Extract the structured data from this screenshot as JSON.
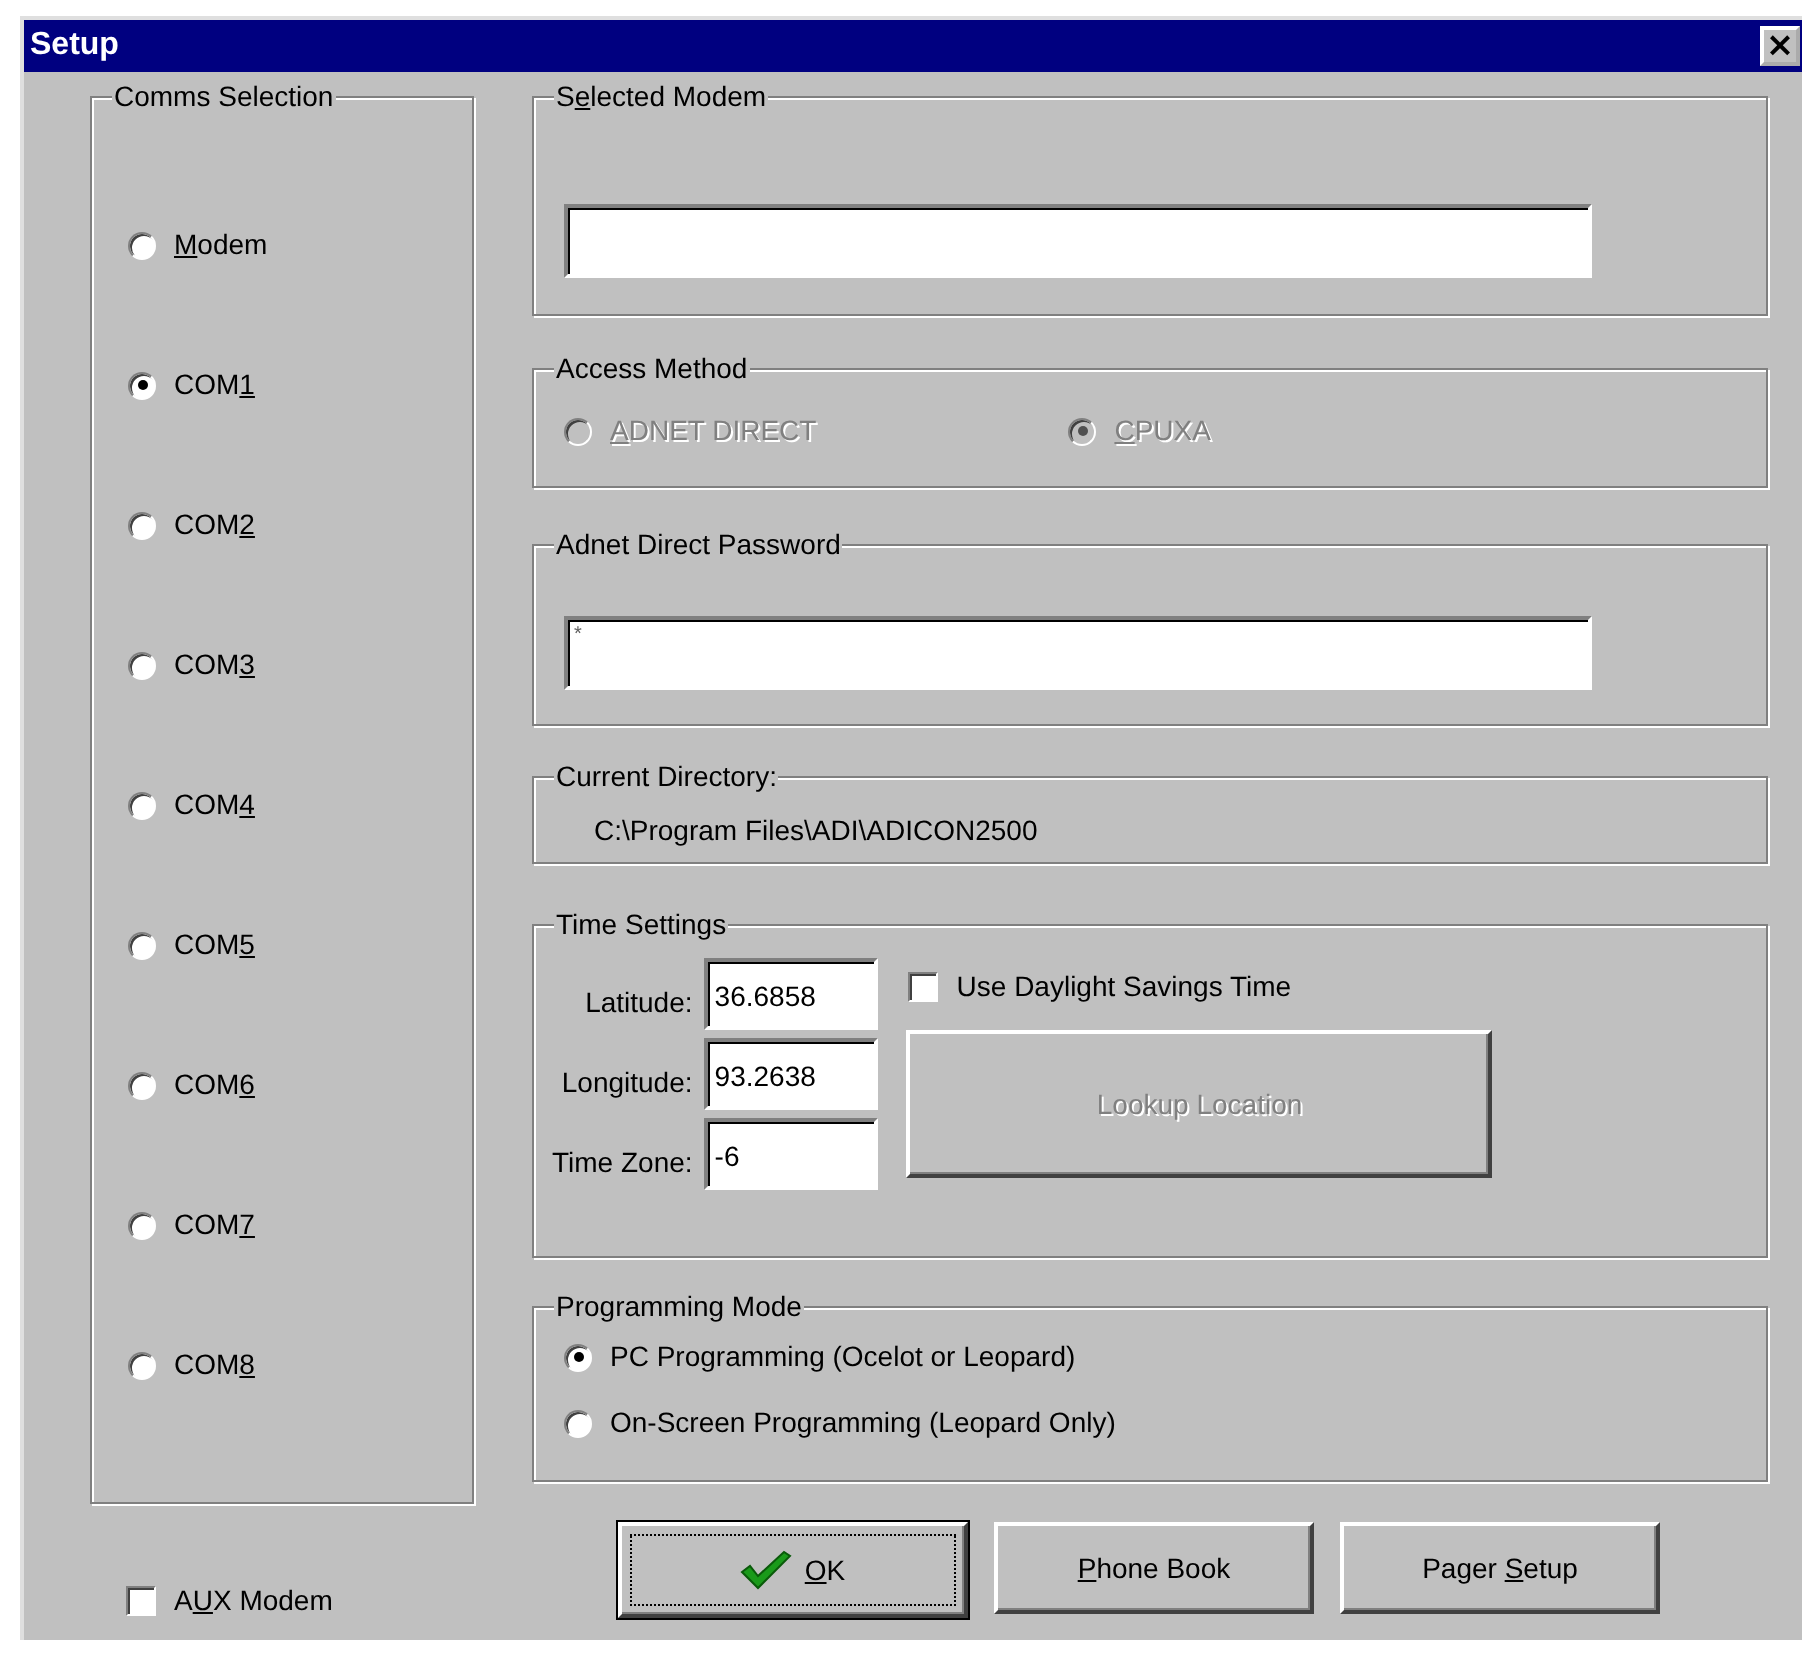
{
  "window": {
    "title": "Setup",
    "close": "×"
  },
  "comms_selection": {
    "title": "Comms Selection",
    "options": [
      {
        "label": [
          {
            "text": "M",
            "underlined": true
          },
          {
            "text": "odem"
          }
        ],
        "selected": false
      },
      {
        "label": [
          {
            "text": "COM"
          },
          {
            "text": "1",
            "underlined": true
          }
        ],
        "selected": true
      },
      {
        "label": [
          {
            "text": "COM"
          },
          {
            "text": "2",
            "underlined": true
          }
        ],
        "selected": false
      },
      {
        "label": [
          {
            "text": "COM"
          },
          {
            "text": "3",
            "underlined": true
          }
        ],
        "selected": false
      },
      {
        "label": [
          {
            "text": "COM"
          },
          {
            "text": "4",
            "underlined": true
          }
        ],
        "selected": false
      },
      {
        "label": [
          {
            "text": "COM"
          },
          {
            "text": "5",
            "underlined": true
          }
        ],
        "selected": false
      },
      {
        "label": [
          {
            "text": "COM"
          },
          {
            "text": "6",
            "underlined": true
          }
        ],
        "selected": false
      },
      {
        "label": [
          {
            "text": "COM"
          },
          {
            "text": "7",
            "underlined": true
          }
        ],
        "selected": false
      },
      {
        "label": [
          {
            "text": "COM"
          },
          {
            "text": "8",
            "underlined": true
          }
        ],
        "selected": false
      }
    ]
  },
  "aux_modem": {
    "label": [
      {
        "text": "A"
      },
      {
        "text": "U",
        "underlined": true
      },
      {
        "text": "X  Modem"
      }
    ],
    "checked": false
  },
  "selected_modem": {
    "title": [
      {
        "text": "S"
      },
      {
        "text": "e",
        "underlined": true
      },
      {
        "text": "lected Modem"
      }
    ]
  },
  "access_method": {
    "title": "Access Method",
    "options": [
      {
        "label": [
          {
            "text": "A",
            "underlined": true
          },
          {
            "text": "DNET DIRECT"
          }
        ],
        "selected": false,
        "disabled": true
      },
      {
        "label": [
          {
            "text": "C",
            "underlined": true
          },
          {
            "text": "PUXA"
          }
        ],
        "selected": true,
        "disabled": true
      }
    ]
  },
  "password": {
    "title": "Adnet Direct Password",
    "value": "*"
  },
  "current_directory": {
    "title": "Current Directory:",
    "value": "C:\\Program Files\\ADI\\ADICON2500"
  },
  "time_settings": {
    "title": "Time Settings",
    "fields": [
      {
        "label": "Latitude:",
        "value": "36.6858"
      },
      {
        "label": "Longitude:",
        "value": "93.2638"
      },
      {
        "label": "Time Zone:",
        "value": "-6"
      }
    ],
    "daylight_savings": {
      "label": "Use Daylight Savings Time",
      "checked": false
    },
    "lookup_button": {
      "label": "Lookup Location",
      "disabled": true
    }
  },
  "programming_mode": {
    "title": "Programming Mode",
    "options": [
      {
        "label": "PC Programming (Ocelot or Leopard)",
        "selected": true
      },
      {
        "label": "On-Screen Programming (Leopard Only)",
        "selected": false
      }
    ]
  },
  "buttons": [
    {
      "kind": "ok",
      "label": [
        {
          "text": "O",
          "underlined": true
        },
        {
          "text": "K"
        }
      ],
      "default": true
    },
    {
      "kind": "plain",
      "label": [
        {
          "text": "P",
          "underlined": true
        },
        {
          "text": "hone Book"
        }
      ],
      "default": false
    },
    {
      "kind": "plain",
      "label": [
        {
          "text": "Pager "
        },
        {
          "text": "S",
          "underlined": true
        },
        {
          "text": "etup"
        }
      ],
      "default": false
    }
  ]
}
